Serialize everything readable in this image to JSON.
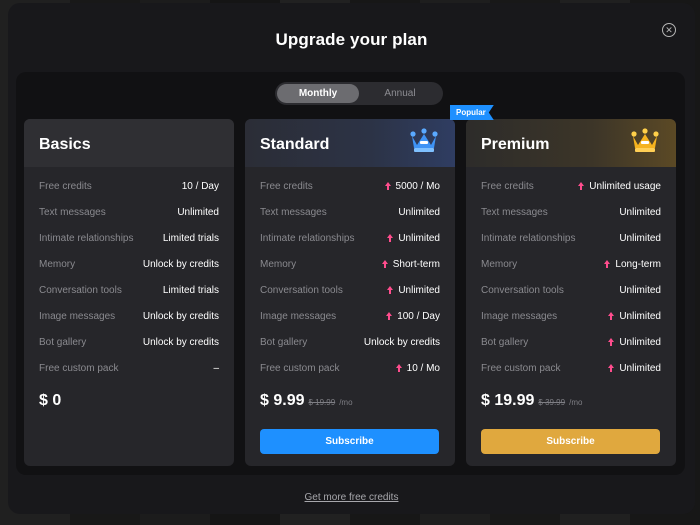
{
  "modal": {
    "title": "Upgrade your plan",
    "close_icon": "close-icon",
    "footer_link": "Get more free credits"
  },
  "billing_toggle": {
    "monthly": "Monthly",
    "annual": "Annual",
    "selected": "Monthly"
  },
  "popular_badge": "Popular",
  "colors": {
    "standard_accent": "#1e90ff",
    "premium_accent": "#e0a83e",
    "upgrade_arrow": "#ff4d8d"
  },
  "plans": [
    {
      "name": "Basics",
      "icon": "",
      "features": [
        {
          "label": "Free credits",
          "value": "10 / Day",
          "upgrade": false
        },
        {
          "label": "Text messages",
          "value": "Unlimited",
          "upgrade": false
        },
        {
          "label": "Intimate relationships",
          "value": "Limited trials",
          "upgrade": false
        },
        {
          "label": "Memory",
          "value": "Unlock by credits",
          "upgrade": false
        },
        {
          "label": "Conversation tools",
          "value": "Limited trials",
          "upgrade": false
        },
        {
          "label": "Image messages",
          "value": "Unlock by credits",
          "upgrade": false
        },
        {
          "label": "Bot gallery",
          "value": "Unlock by credits",
          "upgrade": false
        },
        {
          "label": "Free custom pack",
          "value": "–",
          "upgrade": false
        }
      ],
      "price": "$ 0",
      "old_price": "",
      "period": "",
      "button": ""
    },
    {
      "name": "Standard",
      "icon": "blue-crown-icon",
      "features": [
        {
          "label": "Free credits",
          "value": "5000 / Mo",
          "upgrade": true
        },
        {
          "label": "Text messages",
          "value": "Unlimited",
          "upgrade": false
        },
        {
          "label": "Intimate relationships",
          "value": "Unlimited",
          "upgrade": true
        },
        {
          "label": "Memory",
          "value": "Short-term",
          "upgrade": true
        },
        {
          "label": "Conversation tools",
          "value": "Unlimited",
          "upgrade": true
        },
        {
          "label": "Image messages",
          "value": "100 / Day",
          "upgrade": true
        },
        {
          "label": "Bot gallery",
          "value": "Unlock by credits",
          "upgrade": false
        },
        {
          "label": "Free custom pack",
          "value": "10 / Mo",
          "upgrade": true
        }
      ],
      "price": "$ 9.99",
      "old_price": "$ 19.99",
      "period": "/mo",
      "button": "Subscribe"
    },
    {
      "name": "Premium",
      "icon": "gold-crown-icon",
      "features": [
        {
          "label": "Free credits",
          "value": "Unlimited usage",
          "upgrade": true
        },
        {
          "label": "Text messages",
          "value": "Unlimited",
          "upgrade": false
        },
        {
          "label": "Intimate relationships",
          "value": "Unlimited",
          "upgrade": false
        },
        {
          "label": "Memory",
          "value": "Long-term",
          "upgrade": true
        },
        {
          "label": "Conversation tools",
          "value": "Unlimited",
          "upgrade": false
        },
        {
          "label": "Image messages",
          "value": "Unlimited",
          "upgrade": true
        },
        {
          "label": "Bot gallery",
          "value": "Unlimited",
          "upgrade": true
        },
        {
          "label": "Free custom pack",
          "value": "Unlimited",
          "upgrade": true
        }
      ],
      "price": "$ 19.99",
      "old_price": "$ 39.99",
      "period": "/mo",
      "button": "Subscribe"
    }
  ]
}
